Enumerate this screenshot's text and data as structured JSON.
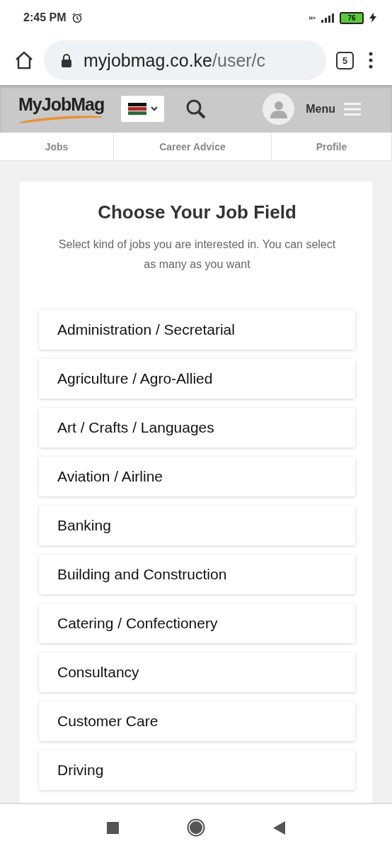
{
  "status_bar": {
    "time": "2:45 PM",
    "network": "H+",
    "battery": "76"
  },
  "browser": {
    "url_host": "myjobmag.co.ke",
    "url_path": "/user/c",
    "tab_count": "5"
  },
  "site_header": {
    "logo": "MyJobMag",
    "menu_label": "Menu"
  },
  "nav_tabs": [
    {
      "label": "Jobs"
    },
    {
      "label": "Career Advice"
    },
    {
      "label": "Profile"
    }
  ],
  "card": {
    "title": "Choose Your Job Field",
    "subtitle": "Select kind of jobs you are interested in. You can select as many as you want",
    "fields": [
      {
        "label": "Administration / Secretarial"
      },
      {
        "label": "Agriculture / Agro-Allied"
      },
      {
        "label": "Art / Crafts / Languages"
      },
      {
        "label": "Aviation / Airline"
      },
      {
        "label": "Banking"
      },
      {
        "label": "Building and Construction"
      },
      {
        "label": "Catering / Confectionery"
      },
      {
        "label": "Consultancy"
      },
      {
        "label": "Customer Care"
      },
      {
        "label": "Driving"
      }
    ]
  }
}
